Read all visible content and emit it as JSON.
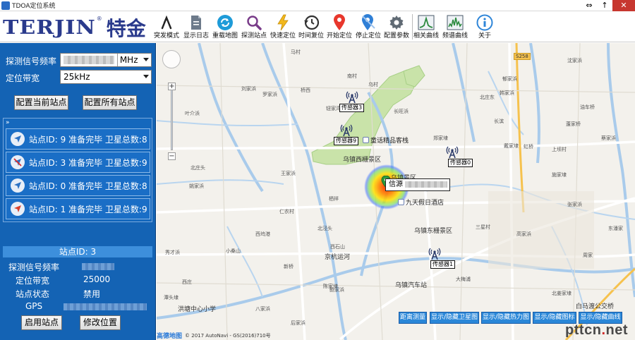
{
  "window": {
    "title": "TDOA定位系统",
    "buttons": [
      "⇔",
      "↑",
      "✕"
    ]
  },
  "logo": {
    "en": "TERJIN",
    "reg": "®",
    "cn": "特金"
  },
  "toolbar": {
    "items": [
      {
        "label": "突发模式",
        "icon": "lambda-icon"
      },
      {
        "label": "显示日志",
        "icon": "document-icon"
      },
      {
        "label": "重载地图",
        "icon": "refresh-icon"
      },
      {
        "label": "探测站点",
        "icon": "search-icon"
      },
      {
        "label": "快速定位",
        "icon": "lightning-icon"
      },
      {
        "label": "时间复位",
        "icon": "clock-reset-icon"
      },
      {
        "label": "开始定位",
        "icon": "map-pin-red-icon"
      },
      {
        "label": "停止定位",
        "icon": "map-pin-blue-icon"
      },
      {
        "label": "配置参数",
        "icon": "gear-icon"
      },
      {
        "label": "相关曲线",
        "icon": "correlation-chart-icon"
      },
      {
        "label": "频谱曲线",
        "icon": "spectrum-chart-icon"
      },
      {
        "label": "关于",
        "icon": "info-icon"
      }
    ]
  },
  "config": {
    "freq_label": "探测信号频率",
    "freq_unit": "MHz",
    "bw_label": "定位带宽",
    "bw_value": "25kHz",
    "btn_config_current": "配置当前站点",
    "btn_config_all": "配置所有站点"
  },
  "stations": {
    "collapse": "»",
    "items": [
      {
        "text": "站点ID:  9 准备完毕 卫星总数:8",
        "icon": "location-arrow-icon"
      },
      {
        "text": "站点ID:  3 准备完毕 卫星总数:9",
        "icon": "location-disabled-icon"
      },
      {
        "text": "站点ID:  0 准备完毕 卫星总数:8",
        "icon": "location-arrow-icon"
      },
      {
        "text": "站点ID:  1 准备完毕 卫星总数:9",
        "icon": "location-arrow-red-icon"
      }
    ]
  },
  "detail": {
    "header": "站点ID: 3",
    "freq_label": "探测信号频率",
    "bw_label": "定位带宽",
    "bw_value": "25000",
    "state_label": "站点状态",
    "state_value": "禁用",
    "gps_label": "GPS",
    "btn_enable": "启用站点",
    "btn_modify": "修改位置"
  },
  "map": {
    "sensors": [
      "传感器3",
      "传感器9",
      "传感器0",
      "传感器1"
    ],
    "result_label": "信源",
    "pois": [
      "童话精品客栈",
      "九天假日酒店"
    ],
    "big_labels": [
      "乌镇西栅景区",
      "乌镇东栅景区",
      "乌镇汽车站",
      "乌镇景区",
      "洪塘中心小学",
      "白马渡公交桥",
      "京杭运河"
    ],
    "road_badge": "S258",
    "place_labels": [
      "马村",
      "南村",
      "乌村",
      "钮家湾",
      "刘家浜",
      "长旺浜",
      "罗家浜",
      "桥西",
      "叶介浜",
      "北庄东",
      "沈家浜",
      "郁家浜",
      "韩家浜",
      "戴家埭",
      "三星村",
      "长滨",
      "西石山",
      "北庄头",
      "姚家浜",
      "秀才浜",
      "小桑山",
      "新桥",
      "西庄",
      "陈家埭",
      "仁农村",
      "北泾头",
      "栖祥",
      "郑家埭",
      "张家浜",
      "施家埭",
      "高家浜",
      "西坞港",
      "大梅浦",
      "虹桥",
      "王家浜",
      "八家浜",
      "后家浜",
      "鲍家浜",
      "潭头埭",
      "上坝村",
      "油车桥",
      "蔡家浜",
      "东潘家",
      "蓬家桥",
      "周家",
      "北姜家埭"
    ],
    "buttons": [
      "距离测量",
      "显示/隐藏卫星图",
      "显示/隐藏热力图",
      "显示/隐藏图标",
      "显示/隐藏曲线"
    ],
    "copyright": "© 2017 AutoNavi - GS(2016)710号",
    "amap": "高德地图",
    "watermark_latin": "pttcn",
    "watermark_dot": ".",
    "watermark_net": "net"
  },
  "colors": {
    "panel": "#1463b4",
    "accent": "#2a87d8",
    "logo": "#2a3a8c"
  }
}
